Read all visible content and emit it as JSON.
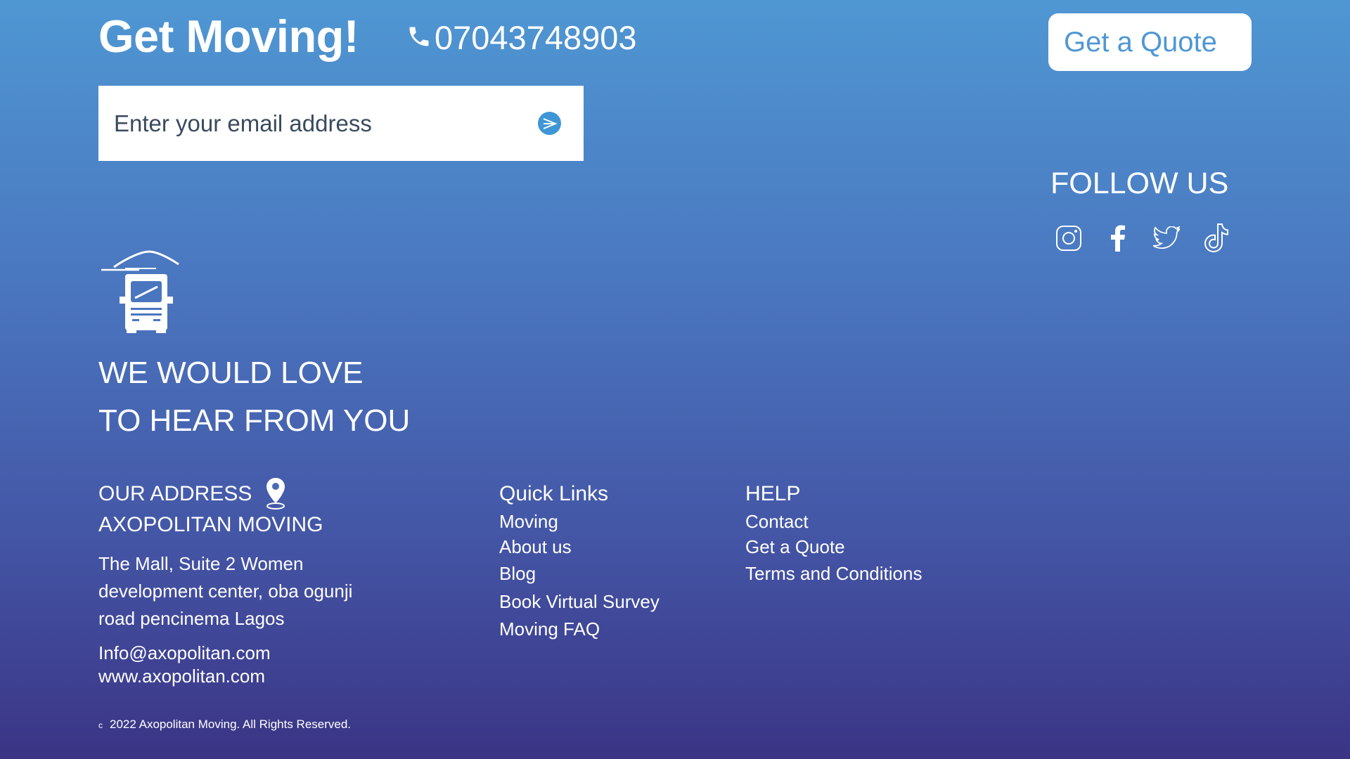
{
  "header": {
    "headline": "Get Moving!",
    "phone": "07043748903",
    "quote_button": "Get a Quote"
  },
  "newsletter": {
    "email_placeholder": "Enter your email address"
  },
  "social": {
    "title": "FOLLOW US",
    "icons": [
      "instagram-icon",
      "facebook-icon",
      "twitter-icon",
      "tiktok-icon"
    ]
  },
  "tagline": {
    "line1": "WE WOULD LOVE",
    "line2": "TO HEAR FROM YOU"
  },
  "address": {
    "title": "OUR ADDRESS",
    "company": "AXOPOLITAN MOVING",
    "line1": "The Mall, Suite 2 Women",
    "line2": "development center, oba ogunji",
    "line3": "road pencinema Lagos",
    "email": "Info@axopolitan.com",
    "website": "www.axopolitan.com"
  },
  "quick_links": {
    "title": "Quick Links",
    "items": [
      "Moving",
      "About us",
      "Blog",
      "Book Virtual Survey",
      "Moving FAQ"
    ]
  },
  "help": {
    "title": "HELP",
    "items": [
      "Contact",
      "Get a Quote",
      "Terms and Conditions"
    ]
  },
  "footer": {
    "copyright_symbol": "c",
    "copyright": "2022 Axopolitan Moving. All Rights Reserved."
  },
  "colors": {
    "gradient_top": "#4f97d3",
    "gradient_bottom": "#3b3485",
    "accent": "#3f96d6"
  }
}
